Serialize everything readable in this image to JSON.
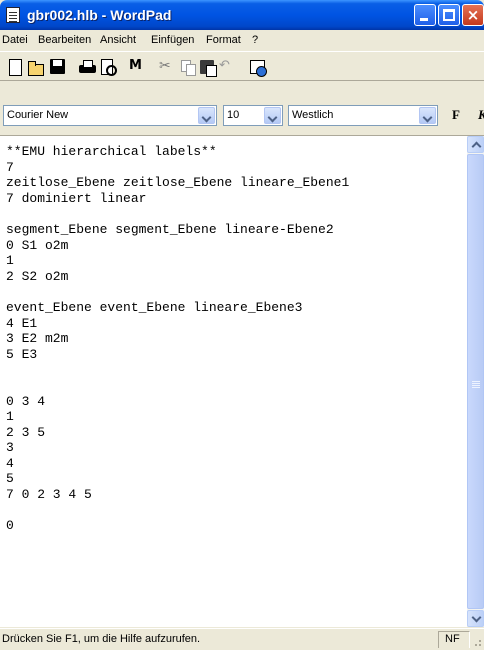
{
  "window": {
    "title": "gbr002.hlb - WordPad",
    "minimize_glyph": "",
    "maximize_glyph": "",
    "close_glyph": "×"
  },
  "menu": {
    "items": [
      "Datei",
      "Bearbeiten",
      "Ansicht",
      "Einfügen",
      "Format",
      "?"
    ]
  },
  "toolbar": {
    "icons": [
      "new-document-icon",
      "open-folder-icon",
      "save-disk-icon",
      "print-icon",
      "print-preview-icon",
      "find-binoculars-icon",
      "cut-scissors-icon",
      "copy-icon",
      "paste-icon",
      "undo-icon",
      "date-time-icon"
    ],
    "find_glyph": "M",
    "cut_glyph": "✂",
    "undo_glyph": "↶"
  },
  "format_bar": {
    "font_name": "Courier New",
    "font_size": "10",
    "script": "Westlich",
    "bold_label": "F",
    "italic_label": "K"
  },
  "document": {
    "lines": [
      "**EMU hierarchical labels**",
      "7",
      "zeitlose_Ebene zeitlose_Ebene lineare_Ebene1",
      "7 dominiert linear",
      "",
      "segment_Ebene segment_Ebene lineare-Ebene2",
      "0 S1 o2m",
      "1",
      "2 S2 o2m",
      "",
      "event_Ebene event_Ebene lineare_Ebene3",
      "4 E1",
      "3 E2 m2m",
      "5 E3",
      "",
      "",
      "0 3 4",
      "1",
      "2 3 5",
      "3",
      "4",
      "5",
      "7 0 2 3 4 5",
      "",
      "0"
    ]
  },
  "status_bar": {
    "help_text": "Drücken Sie F1, um die Hilfe aufzurufen.",
    "mode": "NF"
  },
  "colors": {
    "titlebar": "#0054e3",
    "close_button": "#c4391c",
    "chrome": "#ece9d8",
    "document_bg": "#ffffff"
  }
}
